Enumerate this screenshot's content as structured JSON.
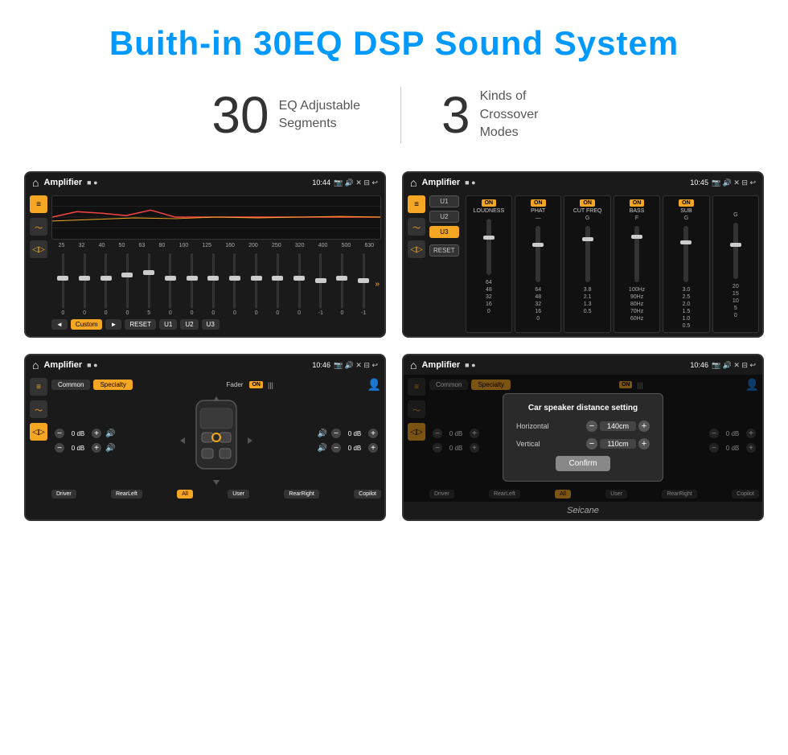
{
  "header": {
    "title": "Buith-in 30EQ DSP Sound System"
  },
  "stats": [
    {
      "number": "30",
      "label": "EQ Adjustable\nSegments"
    },
    {
      "number": "3",
      "label": "Kinds of\nCrossover Modes"
    }
  ],
  "screen1": {
    "appTitle": "Amplifier",
    "time": "10:44",
    "freqLabels": [
      "25",
      "32",
      "40",
      "50",
      "63",
      "80",
      "100",
      "125",
      "160",
      "200",
      "250",
      "320",
      "400",
      "500",
      "630"
    ],
    "sliderValues": [
      "0",
      "0",
      "0",
      "0",
      "5",
      "0",
      "0",
      "0",
      "0",
      "0",
      "0",
      "0",
      "-1",
      "0",
      "-1"
    ],
    "bottomButtons": [
      "◄",
      "Custom",
      "►",
      "RESET",
      "U1",
      "U2",
      "U3"
    ]
  },
  "screen2": {
    "appTitle": "Amplifier",
    "time": "10:45",
    "presets": [
      "U1",
      "U2",
      "U3"
    ],
    "activePreset": "U3",
    "columns": [
      {
        "label": "LOUDNESS",
        "on": true
      },
      {
        "label": "PHAT",
        "on": true
      },
      {
        "label": "CUT FREQ",
        "on": true
      },
      {
        "label": "BASS",
        "on": true
      },
      {
        "label": "SUB",
        "on": true
      }
    ],
    "resetBtn": "RESET"
  },
  "screen3": {
    "appTitle": "Amplifier",
    "time": "10:46",
    "tabs": [
      "Common",
      "Specialty"
    ],
    "activeTab": "Specialty",
    "faderLabel": "Fader",
    "faderOn": "ON",
    "volumeControls": [
      {
        "label": "0 dB",
        "position": "top-left"
      },
      {
        "label": "0 dB",
        "position": "top-right"
      },
      {
        "label": "0 dB",
        "position": "bottom-left"
      },
      {
        "label": "0 dB",
        "position": "bottom-right"
      }
    ],
    "positions": [
      "Driver",
      "RearLeft",
      "All",
      "User",
      "RearRight",
      "Copilot"
    ],
    "activePos": "All"
  },
  "screen4": {
    "appTitle": "Amplifier",
    "time": "10:46",
    "tabs": [
      "Common",
      "Specialty"
    ],
    "activeTab": "Specialty",
    "dialog": {
      "title": "Car speaker distance setting",
      "fields": [
        {
          "label": "Horizontal",
          "value": "140cm"
        },
        {
          "label": "Vertical",
          "value": "110cm"
        }
      ],
      "confirmBtn": "Confirm"
    }
  },
  "watermark": "Seicane"
}
